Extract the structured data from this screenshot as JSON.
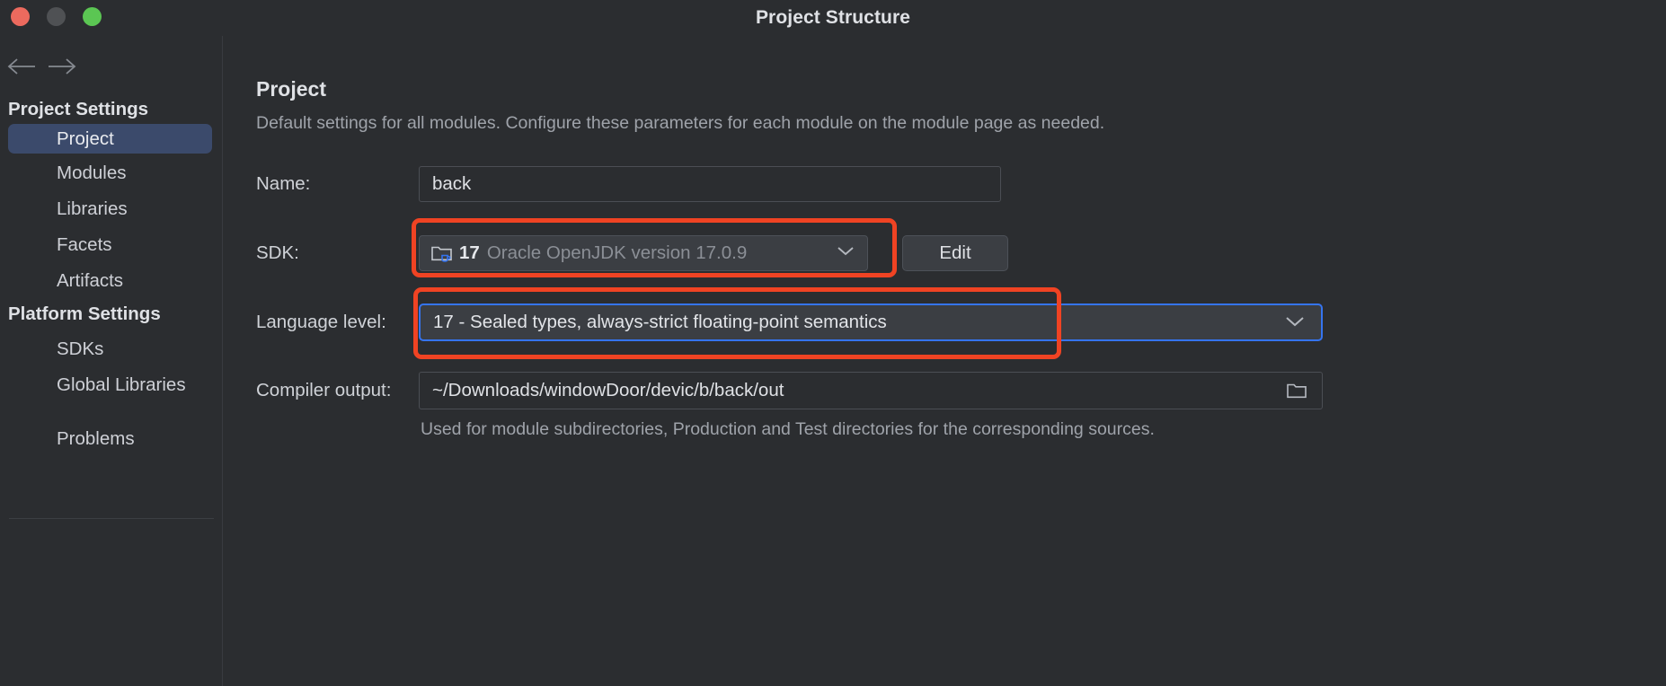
{
  "window": {
    "title": "Project Structure",
    "traffic_lights": [
      {
        "name": "close",
        "color": "#ec6a5e"
      },
      {
        "name": "minimize",
        "color": "#4f5154"
      },
      {
        "name": "zoom",
        "color": "#5bc653"
      }
    ]
  },
  "sidebar": {
    "back_icon": "arrow-left-icon",
    "forward_icon": "arrow-right-icon",
    "groups": [
      {
        "title": "Project Settings",
        "items": [
          {
            "label": "Project",
            "selected": true
          },
          {
            "label": "Modules",
            "selected": false
          },
          {
            "label": "Libraries",
            "selected": false
          },
          {
            "label": "Facets",
            "selected": false
          },
          {
            "label": "Artifacts",
            "selected": false
          }
        ]
      },
      {
        "title": "Platform Settings",
        "items": [
          {
            "label": "SDKs",
            "selected": false
          },
          {
            "label": "Global Libraries",
            "selected": false
          }
        ]
      }
    ],
    "problems": {
      "label": "Problems"
    },
    "selected_bg": "#3b4a6b"
  },
  "main": {
    "title": "Project",
    "description": "Default settings for all modules. Configure these parameters for each module on the module page as needed.",
    "name_row": {
      "label": "Name:",
      "value": "back"
    },
    "sdk_row": {
      "label": "SDK:",
      "version": "17",
      "name": "Oracle OpenJDK version 17.0.9",
      "icon": "jdk-folder-icon",
      "dropdown_icon": "chevron-down-icon",
      "edit_button": "Edit"
    },
    "language_level_row": {
      "label": "Language level:",
      "value": "17 - Sealed types, always-strict floating-point semantics",
      "dropdown_icon": "chevron-down-icon",
      "focus_color": "#3574f0"
    },
    "compiler_output_row": {
      "label": "Compiler output:",
      "value": "~/Downloads/windowDoor/devic/b/back/out",
      "browse_icon": "folder-icon",
      "hint": "Used for module subdirectories, Production and Test directories for the corresponding sources."
    }
  },
  "annotations": {
    "color": "#f04323",
    "boxes": [
      {
        "name": "sdk-highlight"
      },
      {
        "name": "language-level-highlight"
      }
    ]
  }
}
